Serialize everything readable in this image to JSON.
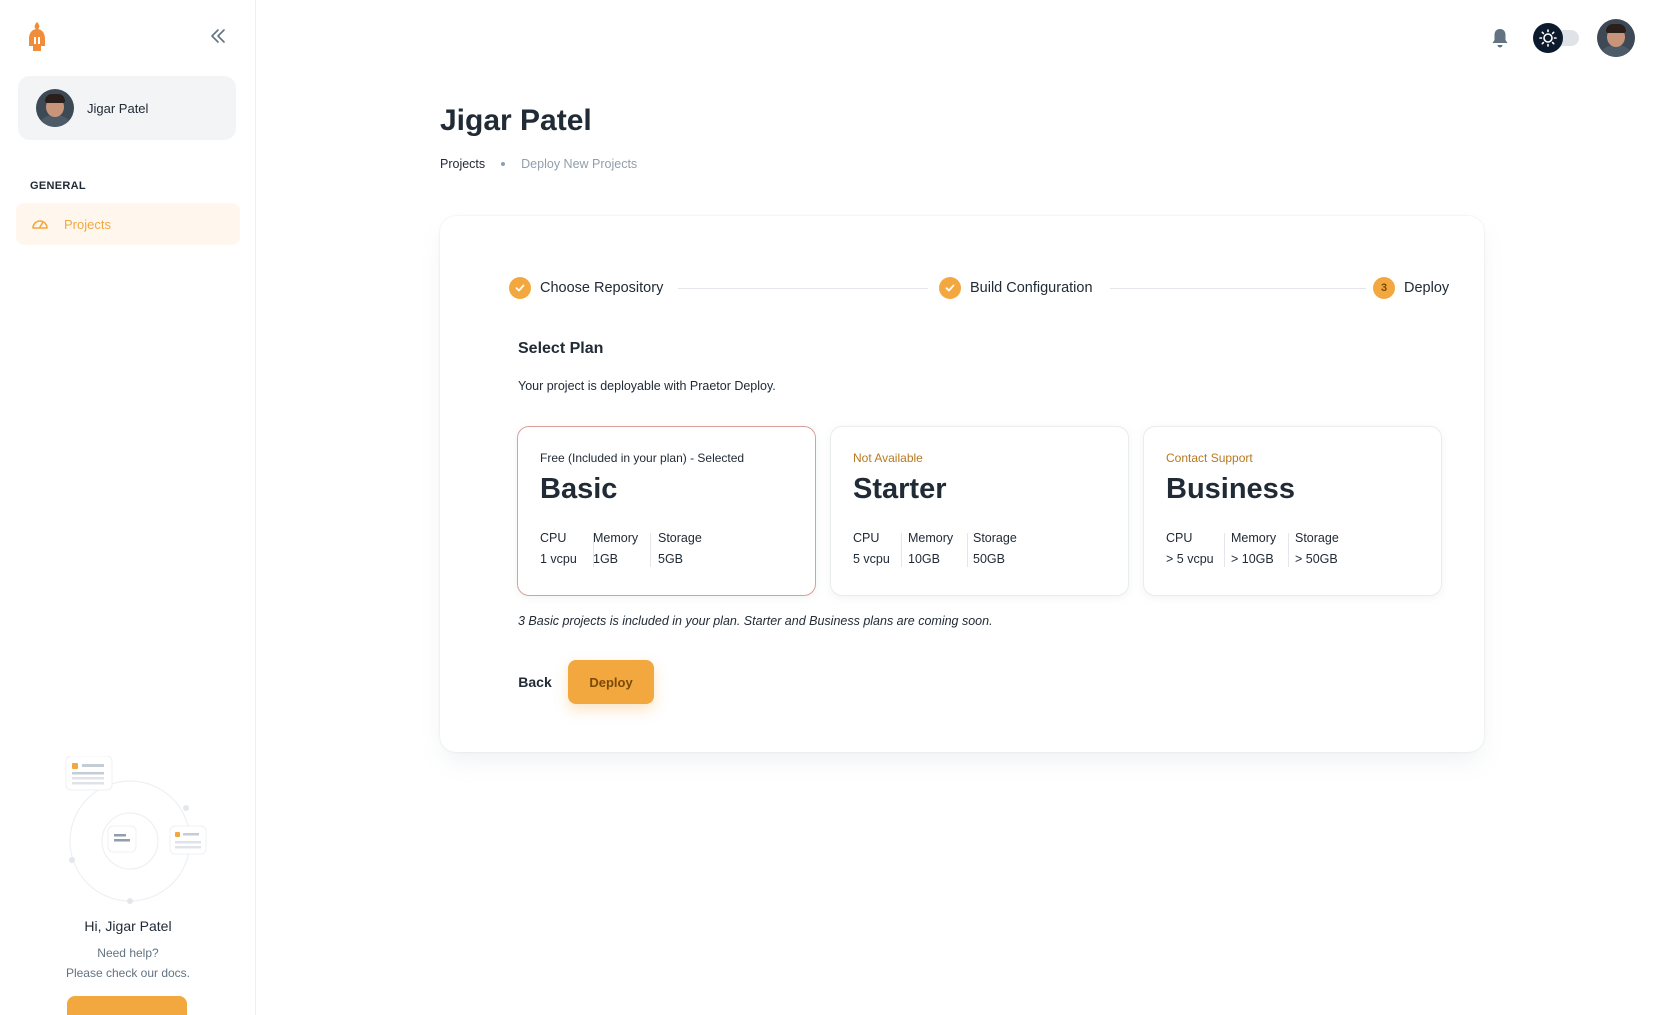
{
  "sidebar": {
    "user_name": "Jigar Patel",
    "section_label": "GENERAL",
    "nav_items": [
      {
        "label": "Projects",
        "icon": "dashboard-icon",
        "active": true
      }
    ],
    "help": {
      "greeting": "Hi, Jigar Patel",
      "line1": "Need help?",
      "line2": "Please check our docs."
    }
  },
  "header": {
    "icons": [
      "bell-icon",
      "sun-icon",
      "avatar"
    ],
    "theme": "light"
  },
  "main": {
    "title": "Jigar Patel",
    "breadcrumb": [
      "Projects",
      "Deploy New Projects"
    ],
    "stepper": [
      {
        "label": "Choose Repository",
        "status": "done"
      },
      {
        "label": "Build Configuration",
        "status": "done"
      },
      {
        "label": "Deploy",
        "status": "active",
        "number": "3"
      }
    ],
    "section_title": "Select Plan",
    "section_note": "Your project is deployable with Praetor Deploy.",
    "plans": [
      {
        "tag": "Free (Included in your plan) - Selected",
        "name": "Basic",
        "selected": true,
        "specs": [
          {
            "label": "CPU",
            "value": "1 vcpu"
          },
          {
            "label": "Memory",
            "value": "1GB"
          },
          {
            "label": "Storage",
            "value": "5GB"
          }
        ]
      },
      {
        "tag": "Not Available",
        "name": "Starter",
        "selected": false,
        "specs": [
          {
            "label": "CPU",
            "value": "5 vcpu"
          },
          {
            "label": "Memory",
            "value": "10GB"
          },
          {
            "label": "Storage",
            "value": "50GB"
          }
        ]
      },
      {
        "tag": "Contact Support",
        "name": "Business",
        "selected": false,
        "specs": [
          {
            "label": "CPU",
            "value": "> 5 vcpu"
          },
          {
            "label": "Memory",
            "value": "> 10GB"
          },
          {
            "label": "Storage",
            "value": "> 50GB"
          }
        ]
      }
    ],
    "footnote": "3 Basic projects is included in your plan. Starter and Business plans are coming soon.",
    "back_label": "Back",
    "deploy_label": "Deploy"
  },
  "colors": {
    "accent": "#f3a73f",
    "tag_selected": "#212b36",
    "tag_unavailable": "#b7791f",
    "tag_contact": "#b7791f"
  }
}
